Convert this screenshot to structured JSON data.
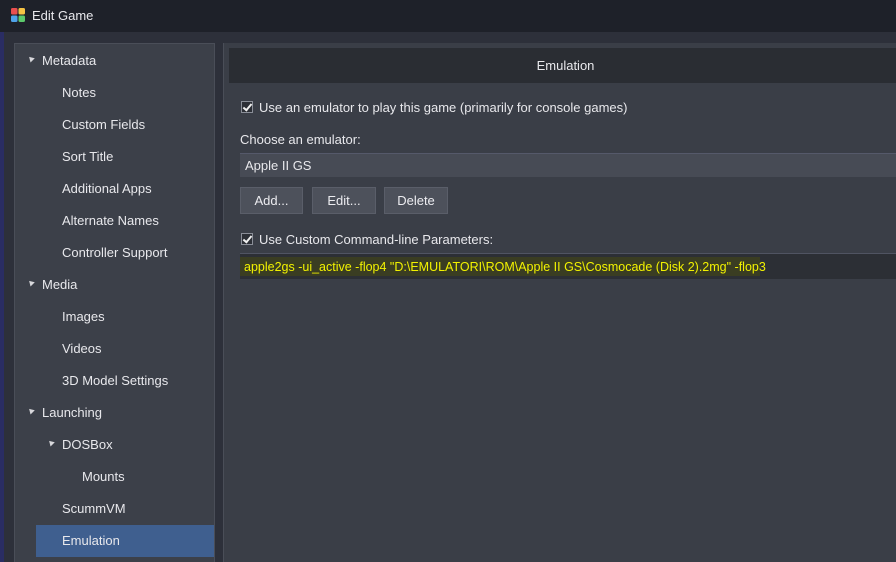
{
  "window": {
    "title": "Edit Game",
    "icon": "launchbox-icon"
  },
  "sidebar": {
    "items": [
      {
        "label": "Metadata",
        "level": 0,
        "expandable": true
      },
      {
        "label": "Notes",
        "level": 1
      },
      {
        "label": "Custom Fields",
        "level": 1
      },
      {
        "label": "Sort Title",
        "level": 1
      },
      {
        "label": "Additional Apps",
        "level": 1
      },
      {
        "label": "Alternate Names",
        "level": 1
      },
      {
        "label": "Controller Support",
        "level": 1
      },
      {
        "label": "Media",
        "level": 0,
        "expandable": true
      },
      {
        "label": "Images",
        "level": 1
      },
      {
        "label": "Videos",
        "level": 1
      },
      {
        "label": "3D Model Settings",
        "level": 1
      },
      {
        "label": "Launching",
        "level": 0,
        "expandable": true
      },
      {
        "label": "DOSBox",
        "level": 1,
        "expandable": true
      },
      {
        "label": "Mounts",
        "level": 2
      },
      {
        "label": "ScummVM",
        "level": 1
      },
      {
        "label": "Emulation",
        "level": 1,
        "selected": true
      }
    ]
  },
  "main": {
    "header": "Emulation",
    "use_emulator": {
      "checked": true,
      "label": "Use an emulator to play this game (primarily for console games)"
    },
    "choose_label": "Choose an emulator:",
    "selected_emulator": "Apple II GS",
    "buttons": {
      "add": "Add...",
      "edit": "Edit...",
      "delete": "Delete"
    },
    "custom_params": {
      "checked": true,
      "label": "Use Custom Command-line Parameters:",
      "value": "apple2gs -ui_active -flop4 \"D:\\EMULATORI\\ROM\\Apple II GS\\Cosmocade (Disk 2).2mg\" -flop3"
    }
  },
  "colors": {
    "selection": "#3f5f8f",
    "highlight_text": "#f2f200",
    "background": "#2d303a"
  }
}
